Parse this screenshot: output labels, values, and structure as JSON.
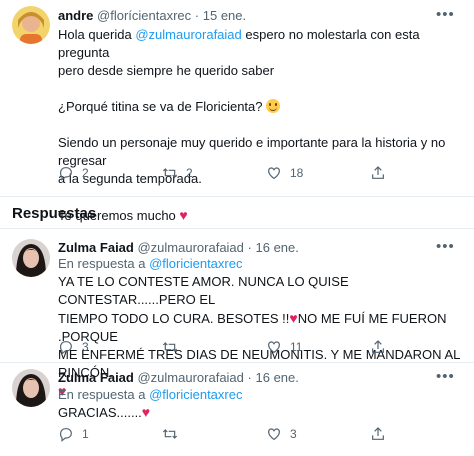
{
  "tweet1": {
    "name": "andre",
    "handle": "@florícientaxrec",
    "date": "15 ene.",
    "more": "•••",
    "greeting": "Hola querida",
    "mention": "@zulmaurorafaiad",
    "line1_rest": "espero no molestarla con esta pregunta",
    "line2": "pero desde siempre he querido saber",
    "question": "¿Porqué titina se va de Floricienta?",
    "line4": "Siendo un personaje muy querido e importante para la historia y no regresar",
    "line5": "a la segunda temporada.",
    "closing": "Te queremos mucho",
    "replies": "2",
    "retweets": "2",
    "likes": "18"
  },
  "section": {
    "title": "Respuestas"
  },
  "reply1": {
    "name": "Zulma Faiad",
    "handle": "@zulmaurorafaiad",
    "date": "16 ene.",
    "more": "•••",
    "reply_prefix": "En respuesta a",
    "reply_to": "@floricientaxrec",
    "line1": "YA TE LO CONTESTE AMOR. NUNCA LO QUISE CONTESTAR......PERO EL",
    "line2": "TIEMPO TODO LO CURA. BESOTES !!",
    "line2b": "NO ME FUÍ ME FUERON .PORQUE",
    "line3": "ME ENFERMÉ TRES DIAS DE NEUMONITIS. Y ME MANDARON AL RINCÓN.",
    "replies": "3",
    "retweets": "",
    "likes": "11"
  },
  "reply2": {
    "name": "Zulma Faiad",
    "handle": "@zulmaurorafaiad",
    "date": "16 ene.",
    "more": "•••",
    "reply_prefix": "En respuesta a",
    "reply_to": "@floricientaxrec",
    "text": "GRACIAS.......",
    "replies": "1",
    "retweets": "",
    "likes": "3"
  },
  "colors": {
    "accent": "#1d9bf0",
    "heart": "#e0245e",
    "muted": "#536471"
  },
  "icons": [
    "reply-icon",
    "retweet-icon",
    "like-icon",
    "share-icon",
    "more-icon"
  ]
}
